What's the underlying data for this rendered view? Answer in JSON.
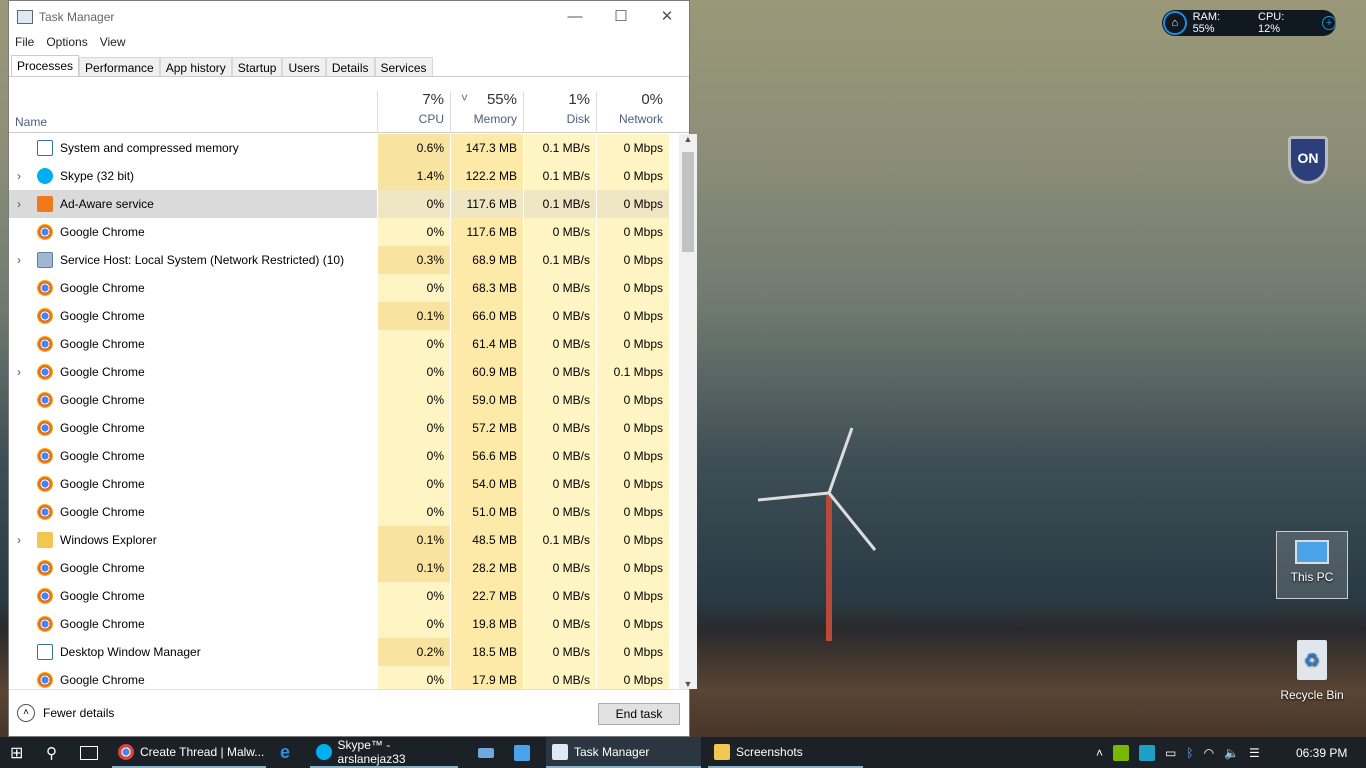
{
  "window": {
    "title": "Task Manager",
    "minimize": "—",
    "maximize": "☐",
    "close": "✕"
  },
  "menu": [
    "File",
    "Options",
    "View"
  ],
  "tabs": [
    "Processes",
    "Performance",
    "App history",
    "Startup",
    "Users",
    "Details",
    "Services"
  ],
  "columns": {
    "name": "Name",
    "cpu": {
      "pct": "7%",
      "label": "CPU"
    },
    "memory": {
      "pct": "55%",
      "label": "Memory",
      "sort": "˅"
    },
    "disk": {
      "pct": "1%",
      "label": "Disk"
    },
    "network": {
      "pct": "0%",
      "label": "Network"
    }
  },
  "processes": [
    {
      "name": "System and compressed memory",
      "expand": false,
      "icon": "system",
      "cpu": "0.6%",
      "memory": "147.3 MB",
      "disk": "0.1 MB/s",
      "network": "0 Mbps"
    },
    {
      "name": "Skype (32 bit)",
      "expand": true,
      "icon": "skype",
      "cpu": "1.4%",
      "memory": "122.2 MB",
      "disk": "0.1 MB/s",
      "network": "0 Mbps"
    },
    {
      "name": "Ad-Aware service",
      "expand": true,
      "icon": "adaware",
      "cpu": "0%",
      "memory": "117.6 MB",
      "disk": "0.1 MB/s",
      "network": "0 Mbps",
      "selected": true
    },
    {
      "name": "Google Chrome",
      "expand": false,
      "icon": "chrome",
      "cpu": "0%",
      "memory": "117.6 MB",
      "disk": "0 MB/s",
      "network": "0 Mbps"
    },
    {
      "name": "Service Host: Local System (Network Restricted) (10)",
      "expand": true,
      "icon": "gear",
      "cpu": "0.3%",
      "memory": "68.9 MB",
      "disk": "0.1 MB/s",
      "network": "0 Mbps"
    },
    {
      "name": "Google Chrome",
      "expand": false,
      "icon": "chrome",
      "cpu": "0%",
      "memory": "68.3 MB",
      "disk": "0 MB/s",
      "network": "0 Mbps"
    },
    {
      "name": "Google Chrome",
      "expand": false,
      "icon": "chrome",
      "cpu": "0.1%",
      "memory": "66.0 MB",
      "disk": "0 MB/s",
      "network": "0 Mbps"
    },
    {
      "name": "Google Chrome",
      "expand": false,
      "icon": "chrome",
      "cpu": "0%",
      "memory": "61.4 MB",
      "disk": "0 MB/s",
      "network": "0 Mbps"
    },
    {
      "name": "Google Chrome",
      "expand": true,
      "icon": "chrome",
      "cpu": "0%",
      "memory": "60.9 MB",
      "disk": "0 MB/s",
      "network": "0.1 Mbps"
    },
    {
      "name": "Google Chrome",
      "expand": false,
      "icon": "chrome",
      "cpu": "0%",
      "memory": "59.0 MB",
      "disk": "0 MB/s",
      "network": "0 Mbps"
    },
    {
      "name": "Google Chrome",
      "expand": false,
      "icon": "chrome",
      "cpu": "0%",
      "memory": "57.2 MB",
      "disk": "0 MB/s",
      "network": "0 Mbps"
    },
    {
      "name": "Google Chrome",
      "expand": false,
      "icon": "chrome",
      "cpu": "0%",
      "memory": "56.6 MB",
      "disk": "0 MB/s",
      "network": "0 Mbps"
    },
    {
      "name": "Google Chrome",
      "expand": false,
      "icon": "chrome",
      "cpu": "0%",
      "memory": "54.0 MB",
      "disk": "0 MB/s",
      "network": "0 Mbps"
    },
    {
      "name": "Google Chrome",
      "expand": false,
      "icon": "chrome",
      "cpu": "0%",
      "memory": "51.0 MB",
      "disk": "0 MB/s",
      "network": "0 Mbps"
    },
    {
      "name": "Windows Explorer",
      "expand": true,
      "icon": "folder",
      "cpu": "0.1%",
      "memory": "48.5 MB",
      "disk": "0.1 MB/s",
      "network": "0 Mbps"
    },
    {
      "name": "Google Chrome",
      "expand": false,
      "icon": "chrome",
      "cpu": "0.1%",
      "memory": "28.2 MB",
      "disk": "0 MB/s",
      "network": "0 Mbps"
    },
    {
      "name": "Google Chrome",
      "expand": false,
      "icon": "chrome",
      "cpu": "0%",
      "memory": "22.7 MB",
      "disk": "0 MB/s",
      "network": "0 Mbps"
    },
    {
      "name": "Google Chrome",
      "expand": false,
      "icon": "chrome",
      "cpu": "0%",
      "memory": "19.8 MB",
      "disk": "0 MB/s",
      "network": "0 Mbps"
    },
    {
      "name": "Desktop Window Manager",
      "expand": false,
      "icon": "system",
      "cpu": "0.2%",
      "memory": "18.5 MB",
      "disk": "0 MB/s",
      "network": "0 Mbps"
    },
    {
      "name": "Google Chrome",
      "expand": false,
      "icon": "chrome",
      "cpu": "0%",
      "memory": "17.9 MB",
      "disk": "0 MB/s",
      "network": "0 Mbps"
    }
  ],
  "footer": {
    "fewer_details": "Fewer details",
    "end_task": "End task"
  },
  "widget": {
    "ram": "RAM: 55%",
    "cpu": "CPU: 12%"
  },
  "shield": "ON",
  "desktop_icons": [
    "This PC",
    "Recycle Bin"
  ],
  "taskbar": {
    "items": [
      "Create Thread | Malw...",
      "Skype™ - arslanejaz33",
      "Task Manager",
      "Screenshots"
    ],
    "clock": "06:39 PM"
  }
}
